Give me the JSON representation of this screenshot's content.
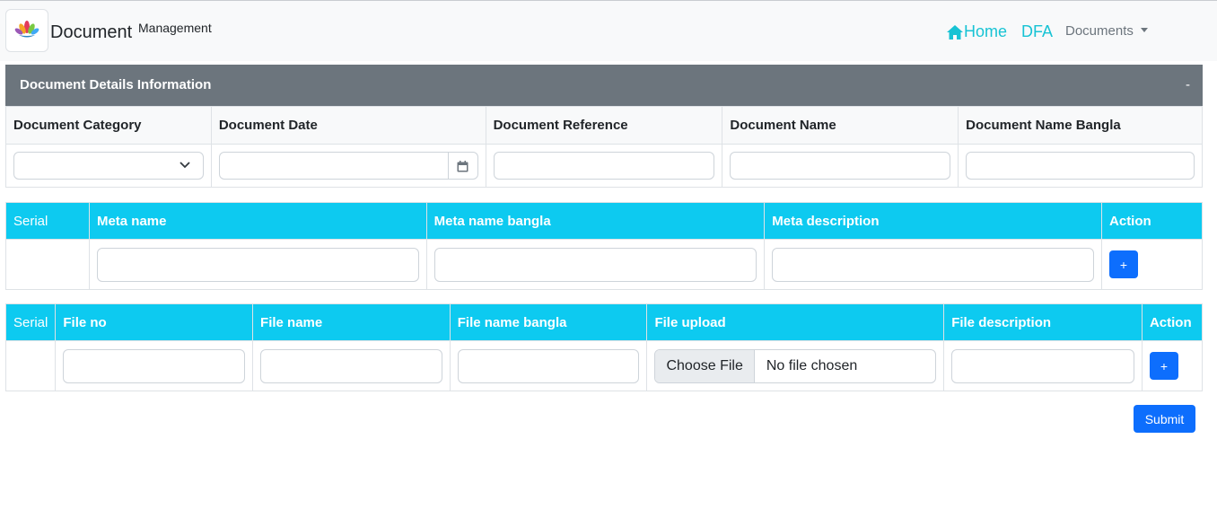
{
  "brand": {
    "name": "Document",
    "sup": "Management"
  },
  "nav": {
    "home": "Home",
    "dfa": "DFA",
    "documents": "Documents"
  },
  "panel": {
    "title": "Document Details Information",
    "toggle": "-"
  },
  "details": {
    "headers": [
      "Document Category",
      "Document Date",
      "Document Reference",
      "Document Name",
      "Document Name Bangla"
    ]
  },
  "meta": {
    "headers": [
      "Serial",
      "Meta name",
      "Meta name bangla",
      "Meta description",
      "Action"
    ],
    "add": "+"
  },
  "files": {
    "headers": [
      "Serial",
      "File no",
      "File name",
      "File name bangla",
      "File upload",
      "File description",
      "Action"
    ],
    "choose": "Choose File",
    "chosen": "No file chosen",
    "add": "+"
  },
  "submit": "Submit",
  "colors": {
    "accent": "#0dcaf0",
    "primary": "#0d6efd",
    "header": "#6c757d",
    "nav_link": "#17c3d4"
  },
  "icons": {
    "logo": "lotus-logo-icon",
    "home": "home-icon",
    "calendar": "calendar-icon",
    "chevron": "chevron-down-icon"
  }
}
